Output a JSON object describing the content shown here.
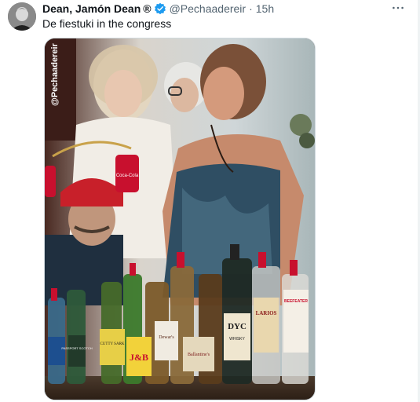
{
  "tweet": {
    "author_name": "Dean, Jamón Dean",
    "registered_mark": "®",
    "handle": "@Pechaadereir",
    "separator": "·",
    "time": "15h",
    "text": "De fiestuki in the congress",
    "verified_icon": "verified-badge-icon",
    "more_icon": "more-options-icon",
    "verified_color": "#1d9bf0"
  },
  "media": {
    "watermark": "@Pechaadereir",
    "bottle_labels": {
      "jb": "J&B",
      "cutty_sark": "CUTTY SARK",
      "passport": "PASSPORT SCOTCH",
      "dewars": "Dewar's",
      "ballantines": "Ballantine's",
      "dyc": "DYC",
      "whisky": "WHISKY",
      "larios": "LARIOS",
      "beefeater": "BEEFEATER",
      "coca_cola": "Coca-Cola"
    }
  }
}
